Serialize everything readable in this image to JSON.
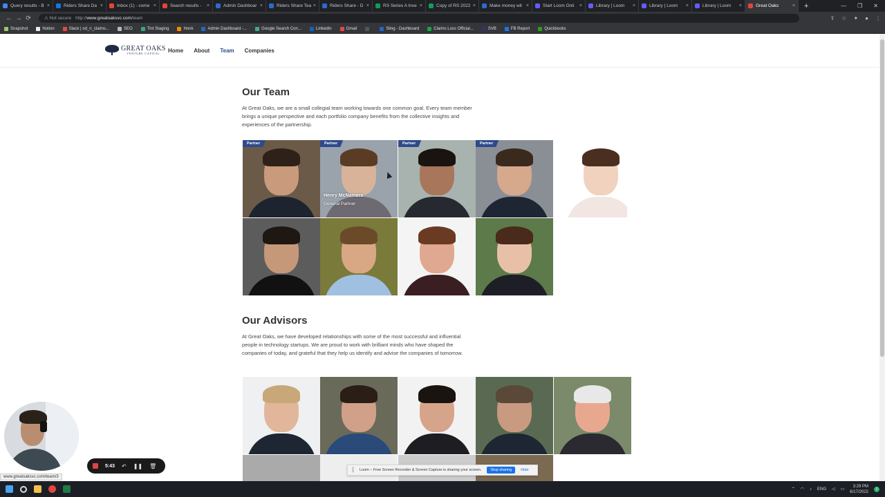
{
  "browser": {
    "tabs": [
      {
        "label": "Query results - B",
        "color": "#4285f4"
      },
      {
        "label": "Riders Share Da",
        "color": "#1a73e8"
      },
      {
        "label": "Inbox (1) - come",
        "color": "#ea4335"
      },
      {
        "label": "Search results -",
        "color": "#ea4335"
      },
      {
        "label": "Admin Dashboar",
        "color": "#2c6bc9"
      },
      {
        "label": "Riders Share Tea",
        "color": "#2c6bc9"
      },
      {
        "label": "Riders Share - D",
        "color": "#2c6bc9"
      },
      {
        "label": "RS Series A Inve",
        "color": "#0f9d58"
      },
      {
        "label": "Copy of RS 2022",
        "color": "#0f9d58"
      },
      {
        "label": "Make money wit",
        "color": "#2c6bc9"
      },
      {
        "label": "Start Loom Onli",
        "color": "#625df5"
      },
      {
        "label": "Library | Loom",
        "color": "#625df5"
      },
      {
        "label": "Library | Loom",
        "color": "#625df5"
      },
      {
        "label": "Library | Loom",
        "color": "#625df5"
      },
      {
        "label": "Great Oaks",
        "color": "#e0463e",
        "active": true
      }
    ],
    "new_tab": "+",
    "security": "Not secure",
    "url_prefix": "http://",
    "url_domain": "www.greatoaksvc.com",
    "url_path": "/team",
    "bookmarks": [
      "Snapshot",
      "Notion",
      "Slack | od_n_claims...",
      "SEO",
      "Tint Staging",
      "Honk",
      "Admin Dashboard -...",
      "Google Search Con...",
      "LinkedIn",
      "Gmail",
      "",
      "Sling - Dashboard",
      "Claims Loss Official...",
      "SVB",
      "FB Report",
      "Quickbooks"
    ]
  },
  "site": {
    "logo_name": "GREAT OAKS",
    "logo_sub": "VENTURE CAPITAL",
    "nav": [
      {
        "label": "Home"
      },
      {
        "label": "About"
      },
      {
        "label": "Team",
        "active": true
      },
      {
        "label": "Companies"
      }
    ]
  },
  "team": {
    "title": "Our Team",
    "description": "At Great Oaks, we are a small collegial team working towards one common goal. Every team member brings a unique perspective and each portfolio company benefits from the collective insights and experiences of the partnership.",
    "badge": "Partner",
    "hover_name": "Henry McNamara",
    "hover_role": "General Partner"
  },
  "advisors": {
    "title": "Our Advisors",
    "description": "At Great Oaks, we have developed relationships with some of the most successful and influential people in technology startups. We are proud to work with brilliant minds who have shaped the companies of today, and grateful that they help us identify and advise the companies of tomorrow."
  },
  "recorder": {
    "time": "5:43",
    "status_url": "www.greatoaksvc.com/team/3",
    "share_text": "Loom – Free Screen Recorder & Screen Capture is sharing your screen.",
    "stop_label": "Stop sharing",
    "hide_label": "Hide"
  },
  "taskbar": {
    "lang": "ENG",
    "time": "3:29 PM",
    "date": "6/17/2022",
    "notifications": "1"
  }
}
